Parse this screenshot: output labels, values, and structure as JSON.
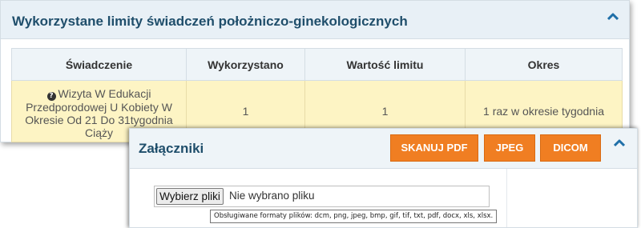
{
  "limits_panel": {
    "title": "Wykorzystane limity świadczeń położniczo-ginekologicznych",
    "collapse_icon": "chevron-up-icon",
    "table": {
      "headers": [
        "Świadczenie",
        "Wykorzystano",
        "Wartość limitu",
        "Okres"
      ],
      "rows": [
        {
          "service_lines": [
            "Wizyta W Edukacji",
            "Przedporodowej U Kobiety W",
            "Okresie Od 21 Do 31tygodnia",
            "Ciąży"
          ],
          "service_icon": "help-icon",
          "used": "1",
          "limit_value": "1",
          "period": "1 raz w okresie tygodnia"
        }
      ]
    },
    "colors": {
      "title": "#1f4e6b",
      "header_bg": "#e8f0f6",
      "row_bg": "#fdf4c4"
    }
  },
  "attachments_panel": {
    "title": "Załączniki",
    "buttons": {
      "scan_pdf": "SKANUJ PDF",
      "jpeg": "JPEG",
      "dicom": "DICOM"
    },
    "collapse_icon": "chevron-up-icon",
    "file_input": {
      "button_label": "Wybierz pliki",
      "status": "Nie wybrano pliku"
    },
    "tooltip": "Obsługiwane formaty plików: dcm, png, jpeg, bmp, gif, tif, txt, pdf, docx, xls, xlsx.",
    "colors": {
      "button_bg": "#f07e22",
      "title": "#1f4e6b"
    }
  }
}
